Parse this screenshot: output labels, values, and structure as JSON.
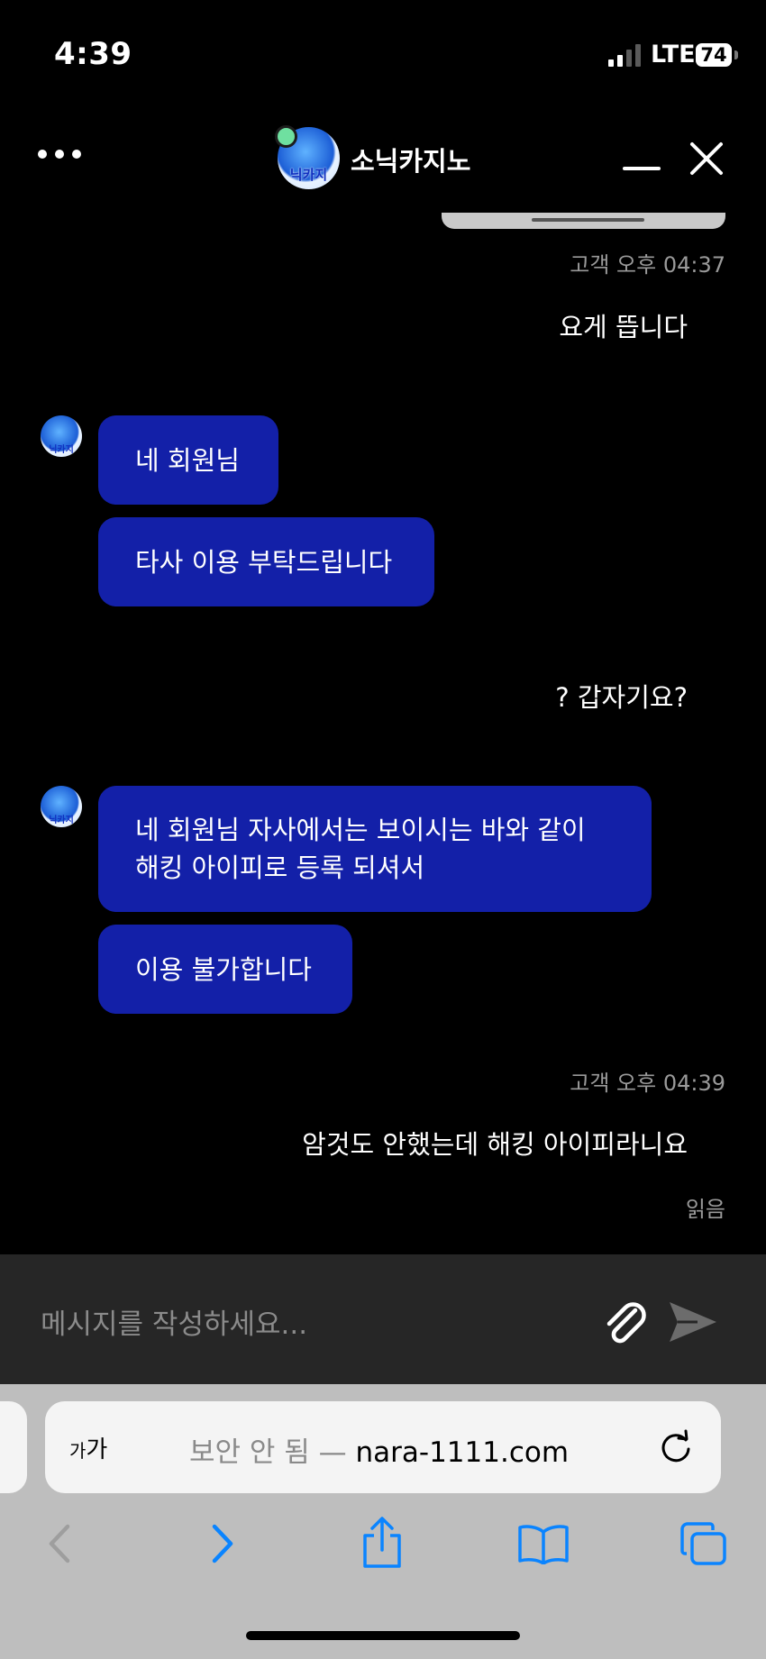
{
  "status_bar": {
    "time": "4:39",
    "network": "LTE",
    "battery": "74"
  },
  "header": {
    "title": "소닉카지노",
    "avatar_label": "닉카지"
  },
  "messages": [
    {
      "role": "meta",
      "text": "고객 오후 04:37"
    },
    {
      "role": "user",
      "text": "요게 뜹니다"
    },
    {
      "role": "agent",
      "bubbles": [
        "네 회원님",
        "타사 이용 부탁드립니다"
      ]
    },
    {
      "role": "user",
      "text": "? 갑자기요?"
    },
    {
      "role": "agent",
      "bubbles": [
        "네 회원님 자사에서는 보이시는 바와 같이",
        "해킹 아이피로 등록 되셔서",
        "이용 불가합니다"
      ]
    },
    {
      "role": "meta",
      "text": "고객 오후 04:39"
    },
    {
      "role": "user",
      "text": "암것도 안했는데 해킹 아이피라니요"
    },
    {
      "role": "meta",
      "text": "읽음"
    }
  ],
  "input": {
    "placeholder": "메시지를 작성하세요..."
  },
  "browser": {
    "text_size_large": "가",
    "text_size_small": "가",
    "security": "보안 안 됨 —",
    "domain": "nara-1111.com"
  },
  "colors": {
    "agent_bubble": "#1320a8",
    "ios_blue": "#0a84ff",
    "online": "#6fe0a0"
  },
  "icons": [
    "more-icon",
    "minimize-icon",
    "close-icon",
    "paperclip-icon",
    "send-icon",
    "reload-icon",
    "back-icon",
    "forward-icon",
    "share-icon",
    "bookmarks-icon",
    "tabs-icon"
  ]
}
